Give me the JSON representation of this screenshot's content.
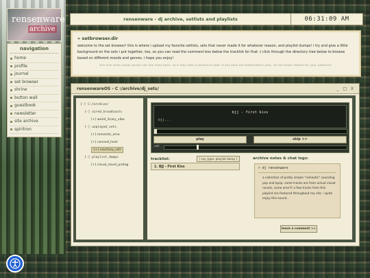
{
  "sidebar": {
    "logo_text_main": "rensenware",
    "logo_text_sub": "archive",
    "nav_title": "navigation",
    "items": [
      "home",
      "profile",
      "journal",
      "set browser",
      "shrine",
      "button wall",
      "guestbook",
      "newsletter",
      "site archive",
      "spiritron"
    ]
  },
  "header": {
    "title": "rensenware - dj archive, setlists and playlists",
    "clock": "06:31:09 AM"
  },
  "intro": {
    "heading": "» setbrowser.dir",
    "body": "welcome to the set browser! this is where i upload my favorite setlists, sets that never made it for whatever reason, and playlist dumps! i try and give a little background on the sets i put together, too, so you can read the comment box below the tracklist for that :) click through the directory tree below to browse based on different moods and genres. i hope you enjoy!",
    "small": "this site hosts songs locally (for the most part), so it may take a second to load. if any sons are broken/don't play, let me know! thanks for your patience!"
  },
  "os_window": {
    "title": "rensenwareOS - C :/archive/dj_sets/",
    "controls": "_ □ X"
  },
  "directory": [
    {
      "text": "[-] C:/archive/",
      "type": "dir",
      "indent": 0
    },
    {
      "text": "[-] aired_broadcasts",
      "type": "dir",
      "indent": 1
    },
    {
      "text": "[+] weird_Scary_vibe",
      "type": "file",
      "indent": 2
    },
    {
      "text": "[-] unplayed_sets",
      "type": "dir",
      "indent": 1
    },
    {
      "text": "[+] romantic_emo",
      "type": "file",
      "indent": 2
    },
    {
      "text": "[+] canned_heat",
      "type": "file",
      "indent": 2
    },
    {
      "text": "[+] courtesy_call",
      "type": "file",
      "indent": 2,
      "selected": true
    },
    {
      "text": "[-] playlist_dumps",
      "type": "dir",
      "indent": 1
    },
    {
      "text": "[+] visual_novel_protag",
      "type": "file",
      "indent": 2
    }
  ],
  "player": {
    "now_playing": "bjj - first kiss",
    "status": "bjj...",
    "progress_fraction": 0.0,
    "play_label": "play",
    "skip_label": "skip >>",
    "vol_label": "vol:",
    "volume_fraction": 0.18
  },
  "tracklist": {
    "label": "tracklist:",
    "type_badge": "[ sys_type: playlist dump ]",
    "tracks": [
      "1. BJJ - First Kiss"
    ]
  },
  "notes": {
    "label": "archive notes & chat logs:",
    "heading": "> dj rensenware",
    "body": "a collection of pretty simple \"romantic\" sounding pop and kpop. some tracks are from actual visual novels, some aren't! a few tracks from this playlist are featured throughout my site. i quite enjoy this sound..",
    "comment_button": "leave a comment >>"
  },
  "colors": {
    "accent_green": "#3e5a3a",
    "panel_cream": "#f2edd9",
    "player_dark": "#1b1f19",
    "a11y_blue": "#1d5fd0"
  }
}
